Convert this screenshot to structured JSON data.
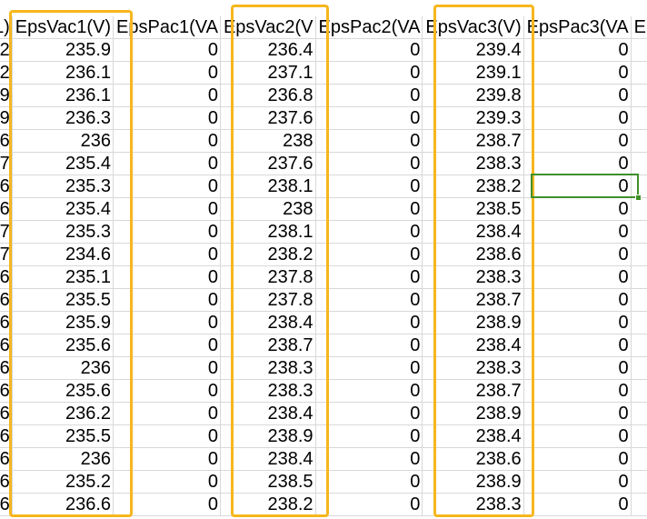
{
  "headers": [
    "L)",
    "EpsVac1(V)",
    "EpsPac1(VA",
    "EpsVac2(V",
    "EpsPac2(VA",
    "EpsVac3(V)",
    "EpsPac3(VA",
    "E"
  ],
  "rows": [
    [
      "2",
      "235.9",
      "0",
      "236.4",
      "0",
      "239.4",
      "0"
    ],
    [
      "2",
      "236.1",
      "0",
      "237.1",
      "0",
      "239.1",
      "0"
    ],
    [
      "9",
      "236.1",
      "0",
      "236.8",
      "0",
      "239.8",
      "0"
    ],
    [
      "9",
      "236.3",
      "0",
      "237.6",
      "0",
      "239.3",
      "0"
    ],
    [
      "6",
      "236",
      "0",
      "238",
      "0",
      "238.7",
      "0"
    ],
    [
      "7",
      "235.4",
      "0",
      "237.6",
      "0",
      "238.3",
      "0"
    ],
    [
      "6",
      "235.3",
      "0",
      "238.1",
      "0",
      "238.2",
      "0"
    ],
    [
      "6",
      "235.4",
      "0",
      "238",
      "0",
      "238.5",
      "0"
    ],
    [
      "7",
      "235.3",
      "0",
      "238.1",
      "0",
      "238.4",
      "0"
    ],
    [
      "7",
      "234.6",
      "0",
      "238.2",
      "0",
      "238.6",
      "0"
    ],
    [
      "6",
      "235.1",
      "0",
      "237.8",
      "0",
      "238.3",
      "0"
    ],
    [
      "6",
      "235.5",
      "0",
      "237.8",
      "0",
      "238.7",
      "0"
    ],
    [
      "6",
      "235.9",
      "0",
      "238.4",
      "0",
      "238.9",
      "0"
    ],
    [
      "6",
      "235.6",
      "0",
      "238.7",
      "0",
      "238.4",
      "0"
    ],
    [
      "6",
      "236",
      "0",
      "238.3",
      "0",
      "238.3",
      "0"
    ],
    [
      "6",
      "235.6",
      "0",
      "238.3",
      "0",
      "238.7",
      "0"
    ],
    [
      "6",
      "236.2",
      "0",
      "238.4",
      "0",
      "238.9",
      "0"
    ],
    [
      "6",
      "235.5",
      "0",
      "238.9",
      "0",
      "238.4",
      "0"
    ],
    [
      "6",
      "236",
      "0",
      "238.4",
      "0",
      "238.6",
      "0"
    ],
    [
      "6",
      "235.2",
      "0",
      "238.5",
      "0",
      "238.9",
      "0"
    ],
    [
      "6",
      "236.6",
      "0",
      "238.2",
      "0",
      "238.3",
      "0"
    ]
  ],
  "colors": {
    "highlight": "#f6b61e",
    "selection": "#3f8f2a",
    "gridline": "#d8d8d8"
  }
}
